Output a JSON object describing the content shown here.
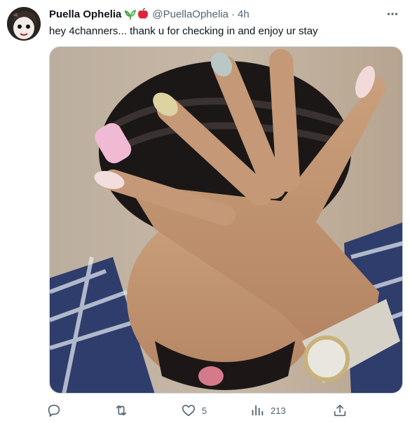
{
  "tweet": {
    "display_name": "Puella Ophelia",
    "name_emojis": [
      "sprout-icon",
      "apple-icon"
    ],
    "handle": "@PuellaOphelia",
    "separator": "·",
    "time": "4h",
    "text": "hey 4channers... thank u for checking in and enjoy ur stay",
    "more_label": "···"
  },
  "actions": {
    "reply": {
      "icon": "reply-icon",
      "count": ""
    },
    "retweet": {
      "icon": "retweet-icon",
      "count": ""
    },
    "like": {
      "icon": "heart-icon",
      "count": "5"
    },
    "views": {
      "icon": "views-chart-icon",
      "count": "213"
    },
    "share": {
      "icon": "share-icon",
      "count": ""
    }
  },
  "colors": {
    "text_primary": "#0f1419",
    "text_secondary": "#536471",
    "border": "#cfd9de"
  }
}
